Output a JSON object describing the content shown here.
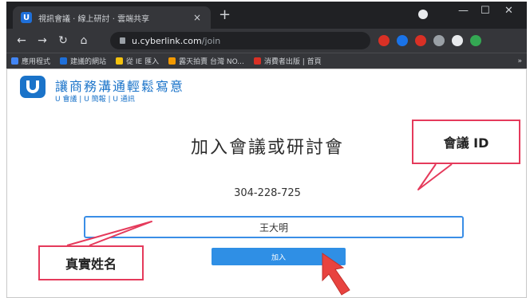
{
  "browser": {
    "tab_title": "視訊會議 · 線上研討 · 雲端共享",
    "tab_close": "×",
    "new_tab": "+",
    "url_host": "u.cyberlink.com",
    "url_path": "/join",
    "window_controls": [
      "—",
      "☐",
      "✕"
    ],
    "bookmarks": [
      {
        "label": "應用程式",
        "color": "#4285f4"
      },
      {
        "label": "建議的網站",
        "color": "#1e6fd9"
      },
      {
        "label": "從 IE 匯入",
        "color": "#f4c20d"
      },
      {
        "label": "露天拍賣 台灣 NO...",
        "color": "#f29900"
      },
      {
        "label": "消費者出版 | 首頁",
        "color": "#d93025"
      }
    ],
    "bookmarks_more": "»",
    "extension_colors": [
      "#d93025",
      "#1a73e8",
      "#d93025",
      "#9aa0a6",
      "#e8eaed",
      "#34a853"
    ]
  },
  "app": {
    "brand_name": "讓商務溝通輕鬆寫意",
    "brand_tagline": "U 會議 | U 簡報 | U 通訊",
    "logo_icon": "u-logo-icon"
  },
  "join": {
    "title": "加入會議或研討會",
    "meeting_id": "304-228-725",
    "name_value": "王大明",
    "join_label": "加入"
  },
  "annotations": {
    "id_label": "會議 ID",
    "name_label": "真實姓名",
    "accent_color": "#e53a5b"
  }
}
